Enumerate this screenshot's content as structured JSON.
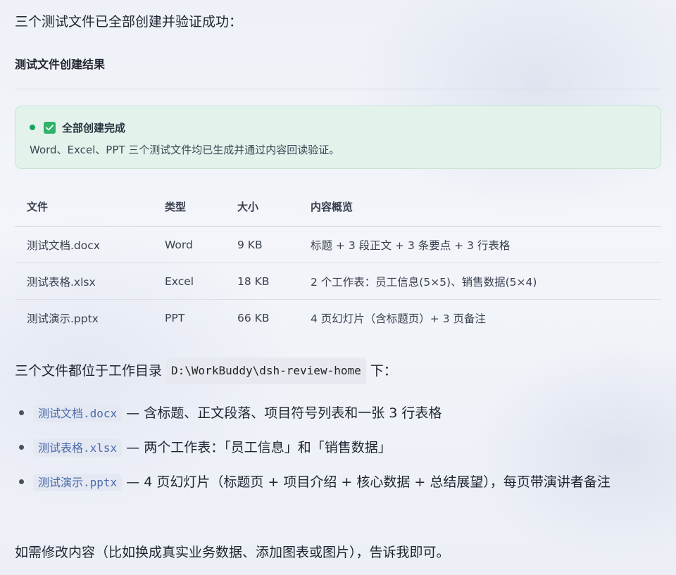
{
  "intro": "三个测试文件已全部创建并验证成功：",
  "section_title": "测试文件创建结果",
  "notice": {
    "title": "全部创建完成",
    "body": "Word、Excel、PPT 三个测试文件均已生成并通过内容回读验证。",
    "accent_color": "#2fb36b"
  },
  "table": {
    "headers": [
      "文件",
      "类型",
      "大小",
      "内容概览"
    ],
    "rows": [
      [
        "测试文档.docx",
        "Word",
        "9 KB",
        "标题 + 3 段正文 + 3 条要点 + 3 行表格"
      ],
      [
        "测试表格.xlsx",
        "Excel",
        "18 KB",
        "2 个工作表：员工信息(5×5)、销售数据(5×4)"
      ],
      [
        "测试演示.pptx",
        "PPT",
        "66 KB",
        "4 页幻灯片（含标题页）+ 3 页备注"
      ]
    ]
  },
  "location": {
    "prefix": "三个文件都位于工作目录",
    "path": "D:\\WorkBuddy\\dsh-review-home",
    "suffix": "下："
  },
  "files": [
    {
      "name": "测试文档.docx",
      "desc": "— 含标题、正文段落、项目符号列表和一张 3 行表格"
    },
    {
      "name": "测试表格.xlsx",
      "desc": "— 两个工作表：「员工信息」和「销售数据」"
    },
    {
      "name": "测试演示.pptx",
      "desc": "— 4 页幻灯片（标题页 + 项目介绍 + 核心数据 + 总结展望），每页带演讲者备注"
    }
  ],
  "outro": "如需修改内容（比如换成真实业务数据、添加图表或图片），告诉我即可。"
}
